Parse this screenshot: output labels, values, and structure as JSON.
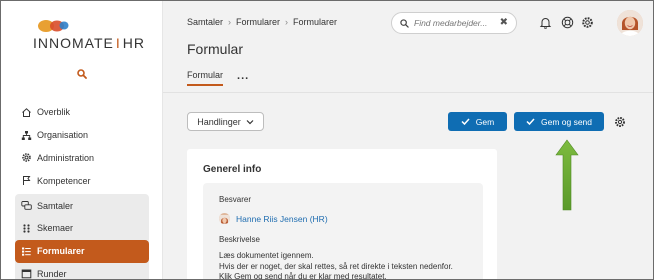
{
  "app": {
    "logo_text_left": "INNOMATE",
    "logo_sep": "I",
    "logo_text_right": "HR"
  },
  "sidebar": {
    "items": [
      {
        "label": "Overblik",
        "icon": "home-icon"
      },
      {
        "label": "Organisation",
        "icon": "org-chart-icon"
      },
      {
        "label": "Administration",
        "icon": "gear-icon"
      },
      {
        "label": "Kompetencer",
        "icon": "flag-icon"
      },
      {
        "label": "Samtaler",
        "icon": "chat-bubbles-icon"
      },
      {
        "label": "Skemaer",
        "icon": "grid-dots-icon"
      },
      {
        "label": "Formularer",
        "icon": "form-list-icon"
      },
      {
        "label": "Runder",
        "icon": "calendar-icon"
      }
    ]
  },
  "header": {
    "breadcrumb": [
      "Samtaler",
      "Formularer",
      "Formularer"
    ],
    "search_placeholder": "Find medarbejder...",
    "page_title": "Formular",
    "tabs": [
      "Formular"
    ],
    "more_label": "..."
  },
  "toolbar": {
    "actions_label": "Handlinger",
    "save_label": "Gem",
    "save_send_label": "Gem og send"
  },
  "card": {
    "title": "Generel info",
    "respondent_label": "Besvarer",
    "respondent_name": "Hanne Riis Jensen (HR)",
    "description_label": "Beskrivelse",
    "description_lines": [
      "Læs dokumentet igennem.",
      "Hvis der er noget, der skal rettes, så ret direkte i teksten nedenfor.",
      "Klik Gem og send når du er klar med resultatet."
    ]
  },
  "colors": {
    "accent": "#c35a1c",
    "primary": "#0f6db3",
    "arrow": "#6aa832",
    "link": "#1f6db0"
  }
}
